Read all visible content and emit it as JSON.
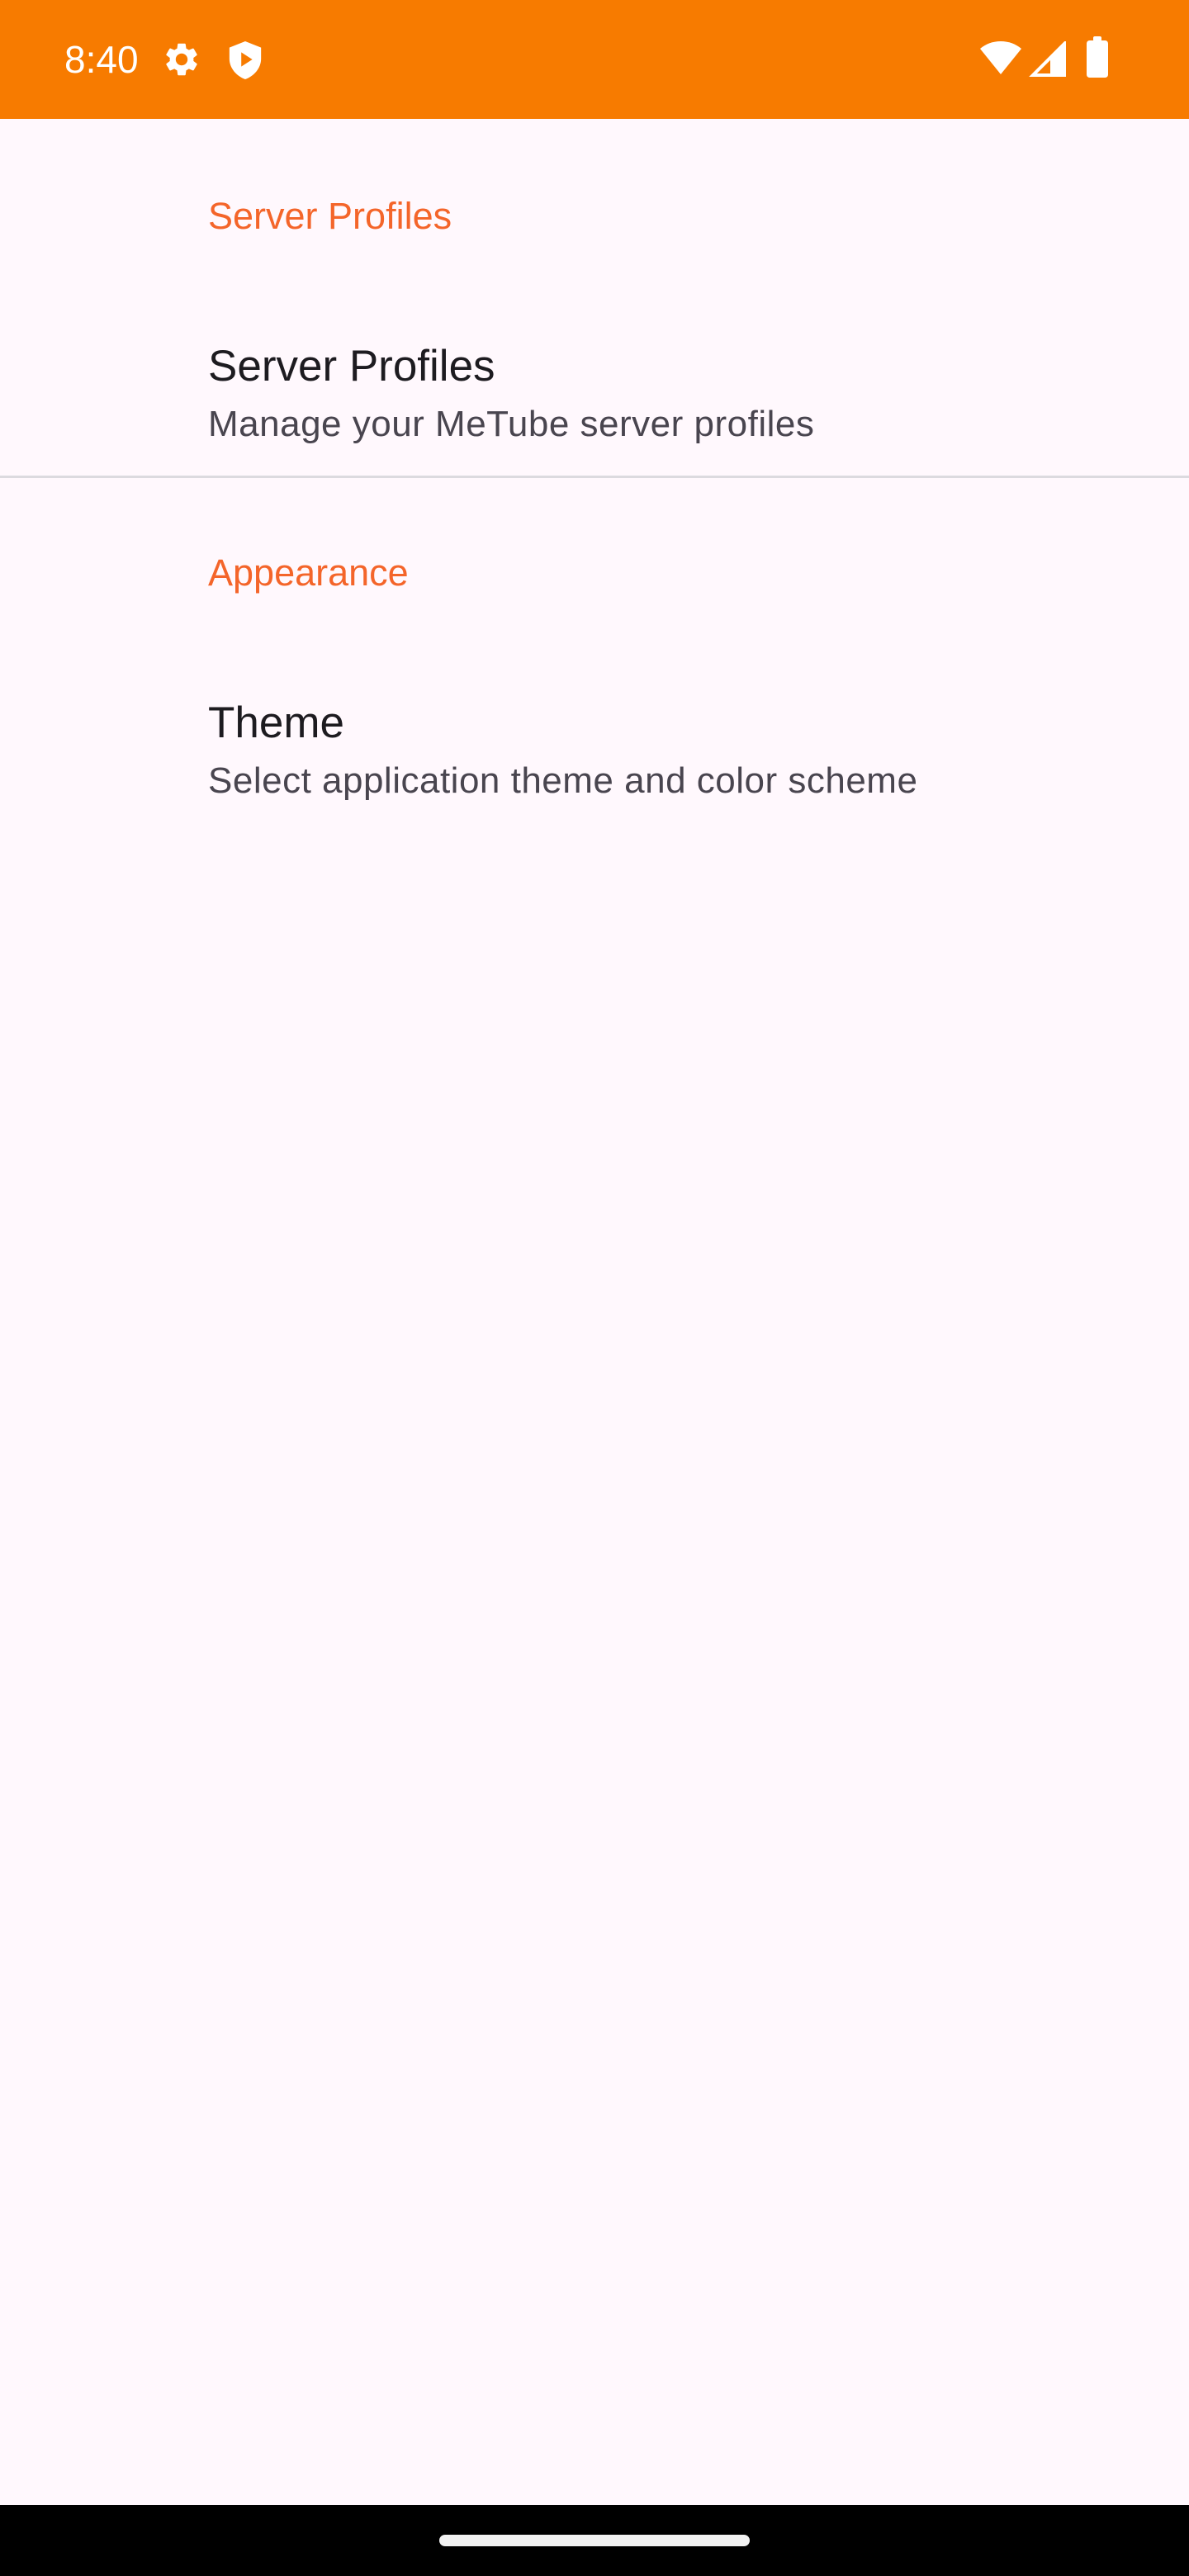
{
  "status_bar": {
    "time": "8:40",
    "background_color": "#F77B00",
    "icons": [
      "settings-gear-icon",
      "shield-play-icon",
      "wifi-icon",
      "cellular-signal-icon",
      "battery-icon"
    ]
  },
  "preferences": {
    "accent_color": "#F4652A",
    "sections": [
      {
        "header": "Server Profiles",
        "items": [
          {
            "title": "Server Profiles",
            "summary": "Manage your MeTube server profiles"
          }
        ]
      },
      {
        "header": "Appearance",
        "items": [
          {
            "title": "Theme",
            "summary": "Select application theme and color scheme"
          }
        ]
      }
    ]
  }
}
